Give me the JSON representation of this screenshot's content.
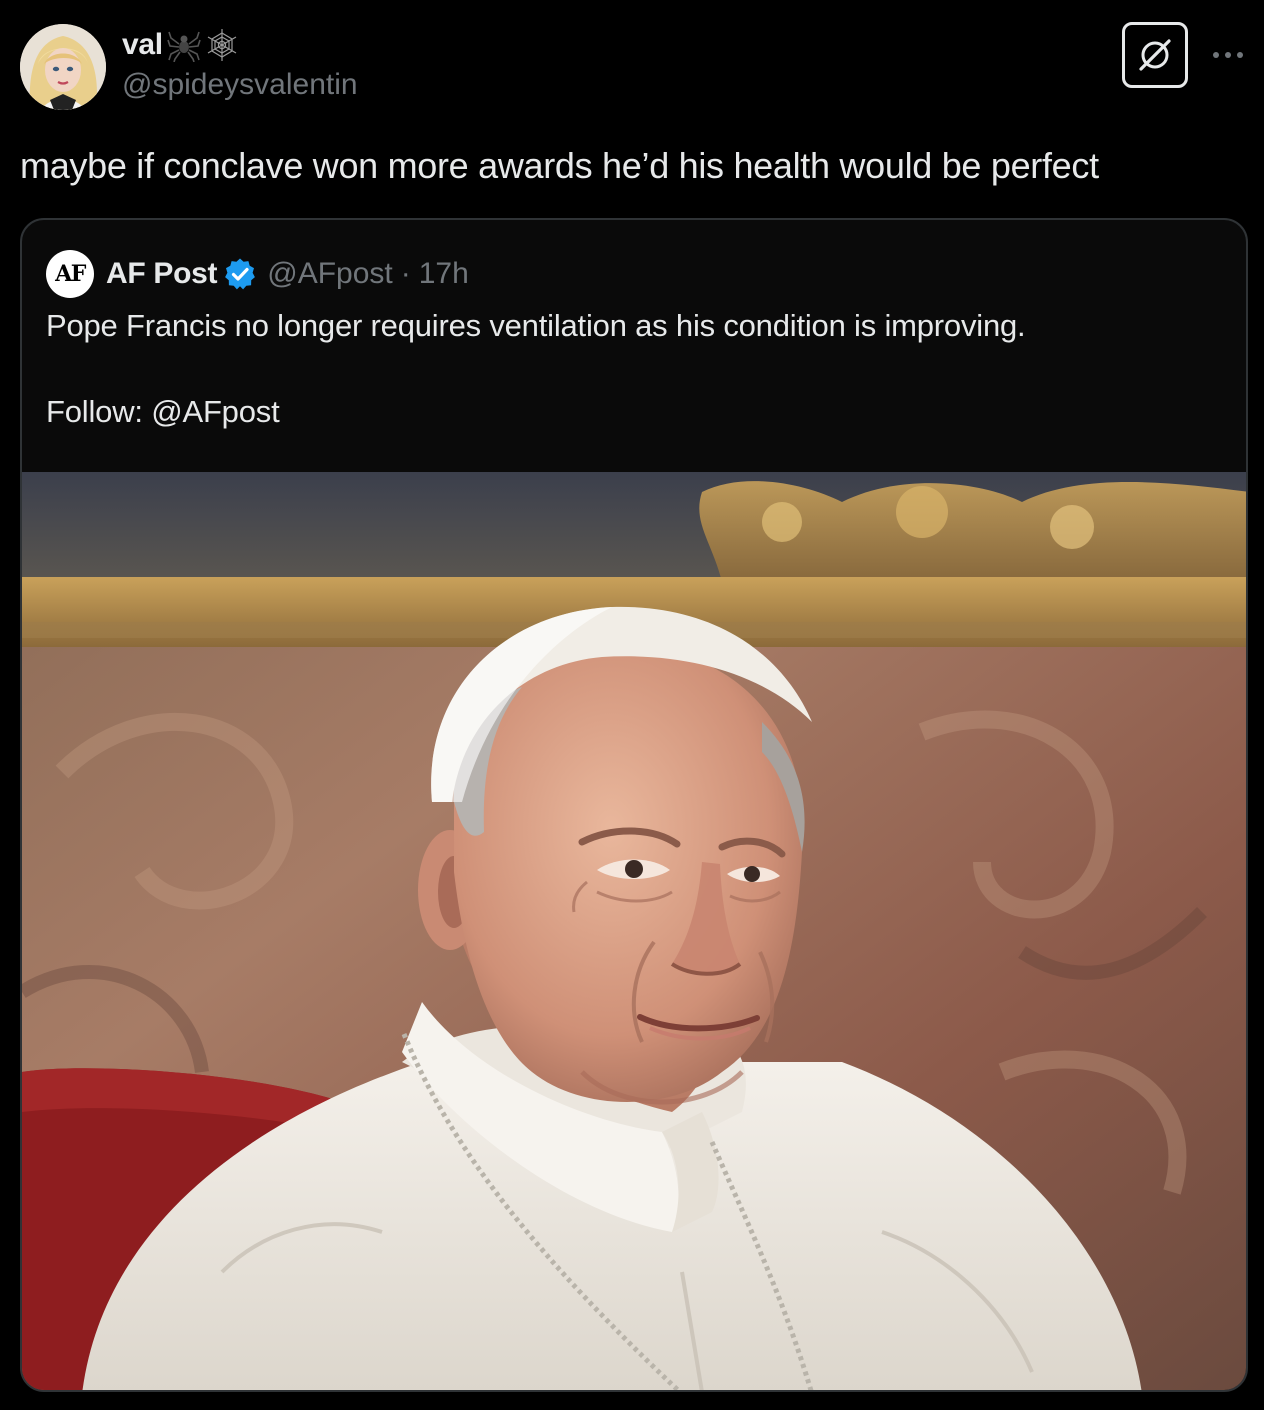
{
  "tweet": {
    "author": {
      "display_name": "val",
      "handle": "@spideysvalentin",
      "emojis": [
        "spider-icon",
        "spider-web-icon"
      ]
    },
    "text": "maybe if conclave won more awards he’d his health would be perfect",
    "actions": {
      "grok_icon": "grok-icon",
      "more_icon": "more-icon"
    }
  },
  "quote": {
    "avatar_text": "AF",
    "display_name": "AF Post",
    "verified": true,
    "handle": "@AFpost",
    "separator": "·",
    "time": "17h",
    "text_line1": "Pope Francis no longer requires ventilation as his condition is improving.",
    "text_line2": "Follow: @AFpost",
    "media": {
      "kind": "photo"
    }
  },
  "colors": {
    "background": "#000000",
    "text_primary": "#e7e9ea",
    "text_secondary": "#71767b",
    "border": "#2f3336",
    "verified_blue": "#1d9bf0"
  }
}
